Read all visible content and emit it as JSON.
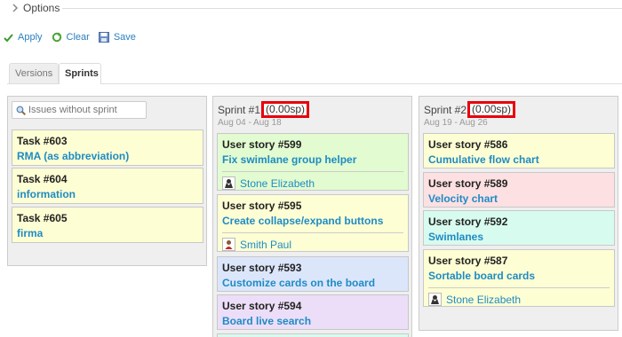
{
  "options": {
    "label": "Options"
  },
  "toolbar": {
    "apply": "Apply",
    "clear": "Clear",
    "save": "Save"
  },
  "tabs": [
    {
      "label": "Versions"
    },
    {
      "label": "Sprints"
    }
  ],
  "backlog": {
    "search_placeholder": "Issues without sprint",
    "cards": [
      {
        "title": "Task #603",
        "subject": "RMA (as abbreviation)"
      },
      {
        "title": "Task #604",
        "subject": "information"
      },
      {
        "title": "Task #605",
        "subject": "firma"
      }
    ]
  },
  "sprints": [
    {
      "name": "Sprint #1",
      "points": "(0.00sp)",
      "dates": "Aug 04 - Aug 18",
      "cards": [
        {
          "title": "User story #599",
          "subject": "Fix swimlane group helper",
          "assignee": "Stone Elizabeth",
          "color": "#e2fbd0"
        },
        {
          "title": "User story #595",
          "subject": "Create collapse/expand buttons",
          "assignee": "Smith Paul",
          "color": "#fefed4"
        },
        {
          "title": "User story #593",
          "subject": "Customize cards on the board",
          "color": "#dce6fb"
        },
        {
          "title": "User story #594",
          "subject": "Board live search",
          "color": "#ecdef8"
        }
      ]
    },
    {
      "name": "Sprint #2",
      "points": "(0.00sp)",
      "dates": "Aug 19 - Aug 26",
      "cards": [
        {
          "title": "User story #586",
          "subject": "Cumulative flow chart",
          "color": "#fefed4"
        },
        {
          "title": "User story #589",
          "subject": "Velocity chart",
          "color": "#fde0e2"
        },
        {
          "title": "User story #592",
          "subject": "Swimlanes",
          "color": "#d8fbef"
        },
        {
          "title": "User story #587",
          "subject": "Sortable board cards",
          "assignee": "Stone Elizabeth",
          "color": "#fefed4"
        }
      ]
    }
  ]
}
